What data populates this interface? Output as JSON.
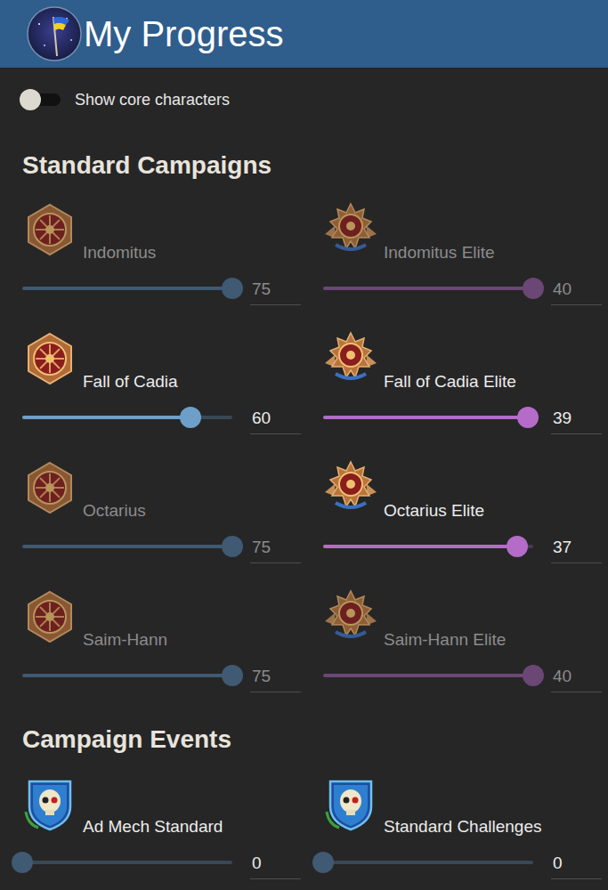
{
  "header": {
    "title": "My Progress"
  },
  "toggle": {
    "label": "Show core characters",
    "on": false
  },
  "sections": [
    {
      "title": "Standard Campaigns",
      "campaigns": [
        {
          "name": "Indomitus",
          "kind": "standard",
          "disabled": true,
          "level": 1,
          "value": "75"
        },
        {
          "name": "Indomitus Elite",
          "kind": "elite",
          "disabled": true,
          "level": 1,
          "value": "40"
        },
        {
          "name": "Fall of Cadia",
          "kind": "standard",
          "disabled": false,
          "level": 0.8,
          "value": "60"
        },
        {
          "name": "Fall of Cadia Elite",
          "kind": "elite",
          "disabled": false,
          "level": 0.975,
          "value": "39"
        },
        {
          "name": "Octarius",
          "kind": "standard",
          "disabled": true,
          "level": 1,
          "value": "75"
        },
        {
          "name": "Octarius Elite",
          "kind": "elite",
          "disabled": false,
          "level": 0.925,
          "value": "37"
        },
        {
          "name": "Saim-Hann",
          "kind": "standard",
          "disabled": true,
          "level": 1,
          "value": "75"
        },
        {
          "name": "Saim-Hann Elite",
          "kind": "elite",
          "disabled": true,
          "level": 1,
          "value": "40"
        }
      ]
    },
    {
      "title": "Campaign Events",
      "campaigns": [
        {
          "name": "Ad Mech Standard",
          "kind": "event",
          "disabled": false,
          "level": 0,
          "value": "0"
        },
        {
          "name": "Standard Challenges",
          "kind": "event",
          "disabled": false,
          "level": 0,
          "value": "0"
        }
      ]
    }
  ]
}
